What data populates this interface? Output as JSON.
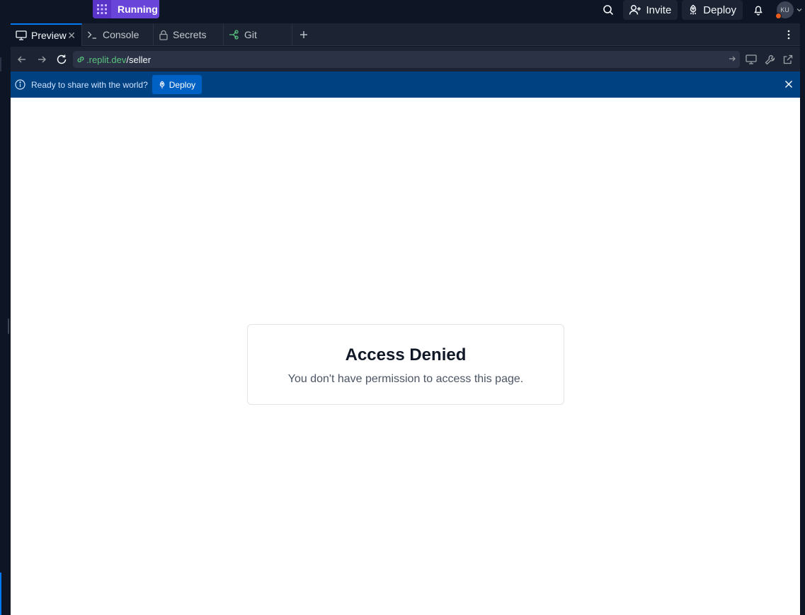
{
  "topbar": {
    "run_label": "Running",
    "invite_label": "Invite",
    "deploy_label": "Deploy",
    "avatar_initials": "KU",
    "icons": [
      "search-icon",
      "add-user-icon",
      "deploy-icon",
      "bell-icon",
      "chevron-down-icon"
    ]
  },
  "tabs": [
    {
      "label": "Preview",
      "icon": "monitor-icon",
      "active": true
    },
    {
      "label": "Console",
      "icon": "terminal-icon"
    },
    {
      "label": "Secrets",
      "icon": "lock-icon"
    },
    {
      "label": "Git",
      "icon": "git-icon"
    }
  ],
  "address": {
    "host": ".replit.dev",
    "path": "/seller"
  },
  "banner": {
    "text": "Ready to share with the world?",
    "button_label": "Deploy"
  },
  "page": {
    "title": "Access Denied",
    "message": "You don't have permission to access this page."
  },
  "colors": {
    "accent": "#0079f2",
    "run": "#6a45d9",
    "banner": "#004182",
    "url_host": "#58c27d"
  }
}
